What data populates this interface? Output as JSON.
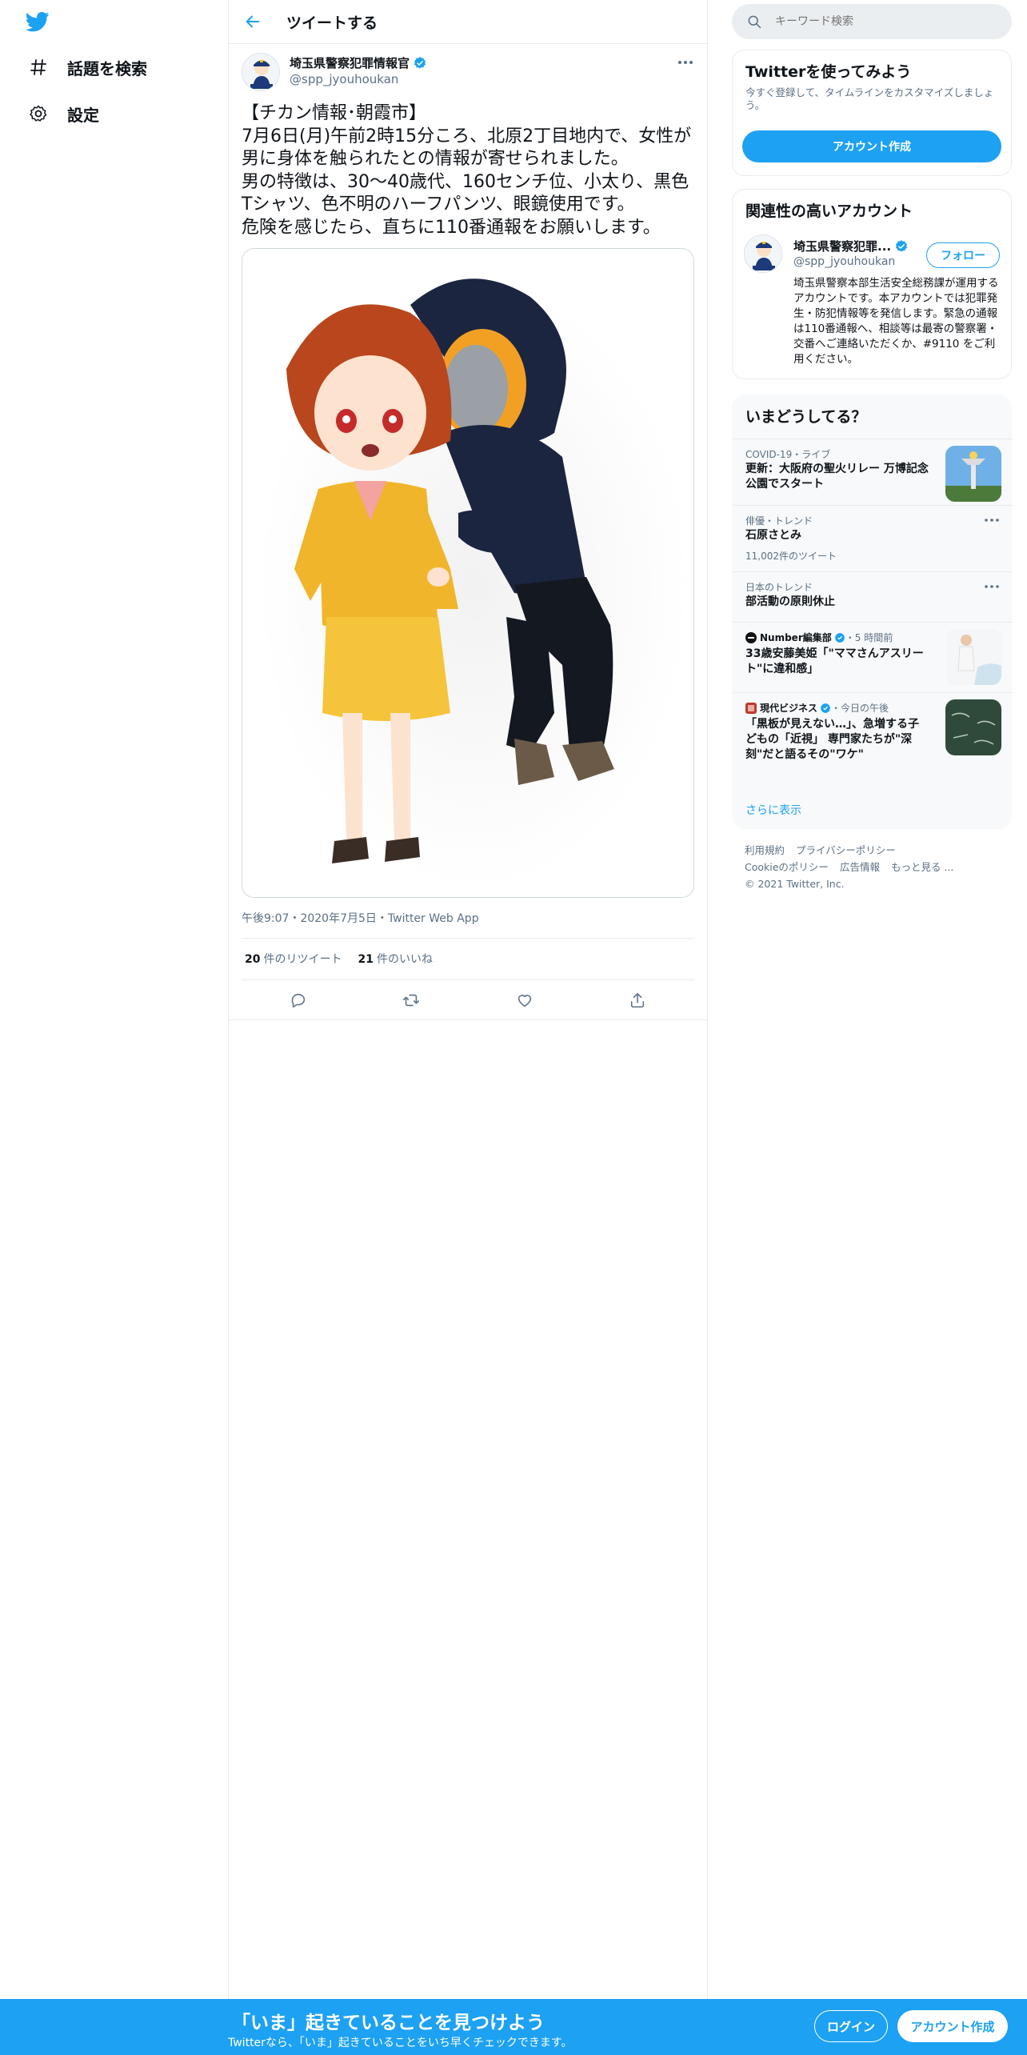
{
  "nav": {
    "explore_label": "話題を検索",
    "settings_label": "設定"
  },
  "header": {
    "title": "ツイートする"
  },
  "tweet": {
    "author_name": "埼玉県警察犯罪情報官",
    "author_handle": "@spp_jyouhoukan",
    "text": "【チカン情報･朝霞市】\n7月6日(月)午前2時15分ころ、北原2丁目地内で、女性が男に身体を触られたとの情報が寄せられました。\n男の特徴は、30～40歳代、160センチ位、小太り、黒色Tシャツ、色不明のハーフパンツ、眼鏡使用です。\n危険を感じたら、直ちに110番通報をお願いします。",
    "meta": "午後9:07・2020年7月5日・Twitter Web App",
    "retweets_count": "20",
    "retweets_label": "件のリツイート",
    "likes_count": "21",
    "likes_label": "件のいいね"
  },
  "search": {
    "placeholder": "キーワード検索"
  },
  "signup_card": {
    "title": "Twitterを使ってみよう",
    "description": "今すぐ登録して、タイムラインをカスタマイズしましょう。",
    "button": "アカウント作成"
  },
  "related": {
    "title": "関連性の高いアカウント",
    "name": "埼玉県警察犯罪...",
    "handle": "@spp_jyouhoukan",
    "follow": "フォロー",
    "bio": "埼玉県警察本部生活安全総務課が運用するアカウントです。本アカウントでは犯罪発生・防犯情報等を発信します。緊急の通報は110番通報へ、相談等は最寄の警察署・交番へご連絡いただくか、#9110 をご利用ください。"
  },
  "trends": {
    "title": "いまどうしてる？",
    "items": [
      {
        "context": "COVID-19・ライブ",
        "title": "更新：大阪府の聖火リレー 万博記念公園でスタート"
      },
      {
        "context": "俳優・トレンド",
        "title": "石原さとみ",
        "sub": "11,002件のツイート"
      },
      {
        "context": "日本のトレンド",
        "title": "部活動の原則休止"
      },
      {
        "source": "Number編集部",
        "time": "・5 時間前",
        "title": "33歳安藤美姫「\"ママさんアスリート\"に違和感」"
      },
      {
        "source": "現代ビジネス",
        "time": "・今日の午後",
        "title": "「黒板が見えない…」、急増する子どもの「近視」 専門家たちが\"深刻\"だと語るその\"ワケ\""
      }
    ],
    "show_more": "さらに表示"
  },
  "footer": {
    "terms": "利用規約",
    "privacy": "プライバシーポリシー",
    "cookie": "Cookieのポリシー",
    "ads": "広告情報",
    "more": "もっと見る ...",
    "copyright": "© 2021 Twitter, Inc."
  },
  "bottombar": {
    "headline": "「いま」起きていることを見つけよう",
    "subline": "Twitterなら、「いま」起きていることをいち早くチェックできます。",
    "login": "ログイン",
    "signup": "アカウント作成"
  },
  "colors": {
    "accent": "#1da1f2",
    "text": "#0f1419",
    "secondary": "#5b7083",
    "border": "#e6ecf0"
  }
}
